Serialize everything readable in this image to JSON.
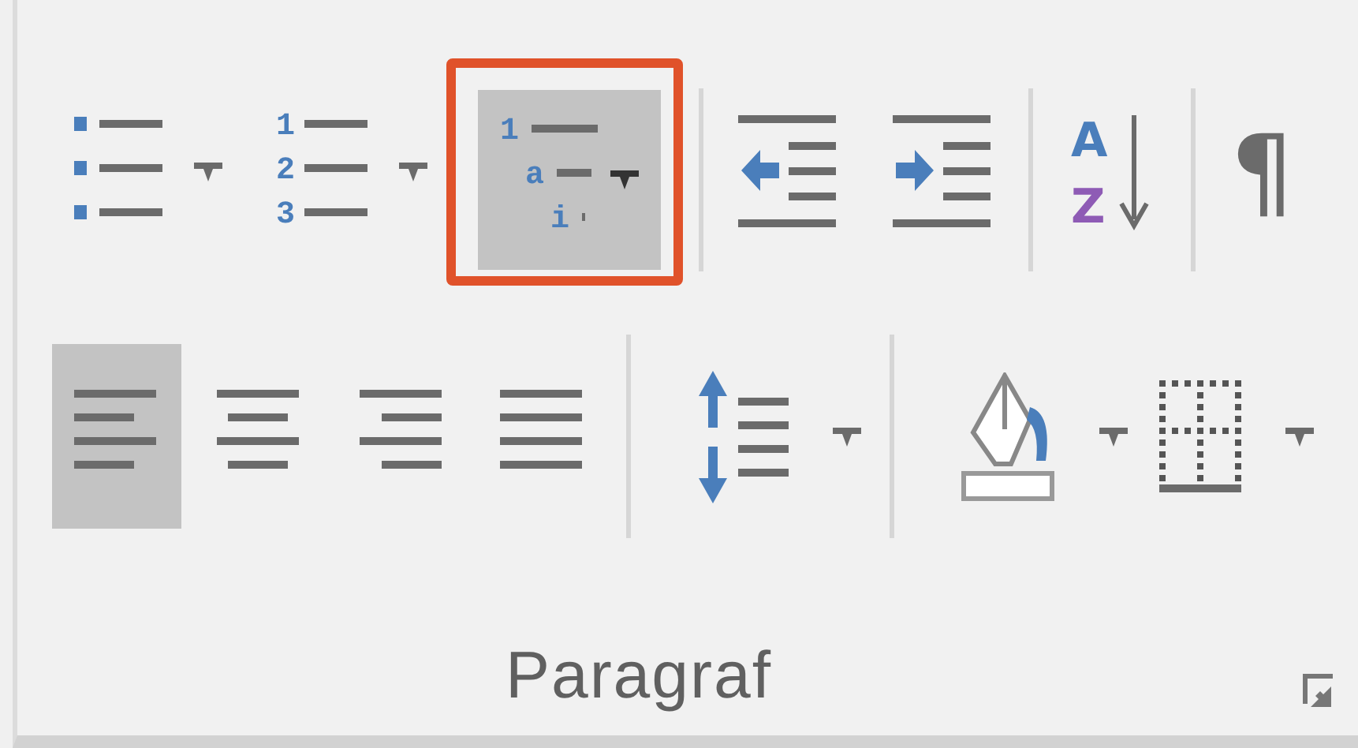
{
  "ribbon": {
    "label": "Paragraf",
    "rows": [
      [
        [
          {
            "kind": "bullets",
            "selected": false,
            "dropdown": true,
            "highlighted": false
          },
          {
            "kind": "numbering",
            "selected": false,
            "dropdown": true,
            "highlighted": false,
            "glyphs": [
              "1",
              "2",
              "3"
            ]
          },
          {
            "kind": "multilevel",
            "selected": true,
            "dropdown": true,
            "highlighted": true,
            "glyphs": [
              "1",
              "a",
              "i"
            ]
          }
        ],
        [
          {
            "kind": "decrease-indent",
            "selected": false,
            "dropdown": false,
            "highlighted": false
          },
          {
            "kind": "increase-indent",
            "selected": false,
            "dropdown": false,
            "highlighted": false
          }
        ],
        [
          {
            "kind": "sort",
            "selected": false,
            "dropdown": false,
            "highlighted": false,
            "glyphs": [
              "A",
              "Z"
            ]
          }
        ],
        [
          {
            "kind": "show-marks",
            "selected": false,
            "dropdown": false,
            "highlighted": false,
            "glyphs": [
              "¶"
            ]
          }
        ]
      ],
      [
        [
          {
            "kind": "align-left",
            "selected": true,
            "dropdown": false,
            "highlighted": false
          },
          {
            "kind": "align-center",
            "selected": false,
            "dropdown": false,
            "highlighted": false
          },
          {
            "kind": "align-right",
            "selected": false,
            "dropdown": false,
            "highlighted": false
          },
          {
            "kind": "justify",
            "selected": false,
            "dropdown": false,
            "highlighted": false
          }
        ],
        [
          {
            "kind": "line-spacing",
            "selected": false,
            "dropdown": true,
            "highlighted": false
          }
        ],
        [
          {
            "kind": "shading",
            "selected": false,
            "dropdown": true,
            "highlighted": false
          },
          {
            "kind": "borders",
            "selected": false,
            "dropdown": true,
            "highlighted": false
          }
        ]
      ]
    ]
  }
}
